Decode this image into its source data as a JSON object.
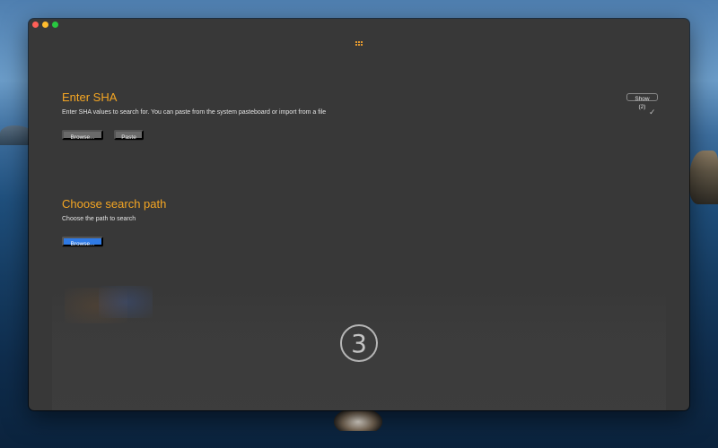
{
  "window": {
    "title": ""
  },
  "sections": {
    "enter_sha": {
      "title": "Enter SHA",
      "description": "Enter SHA values to search for. You can paste from the system pasteboard or import from a file",
      "browse_label": "Browse...",
      "paste_label": "Paste",
      "show_label": "Show (2)",
      "status_icon": "checkmark-icon"
    },
    "search_path": {
      "title": "Choose search path",
      "description": "Choose the path to search",
      "browse_label": "Browse..."
    }
  },
  "step": {
    "number": "3"
  },
  "colors": {
    "accent_orange": "#f5a623",
    "primary_blue": "#2f7ae5",
    "window_bg": "#383838"
  }
}
